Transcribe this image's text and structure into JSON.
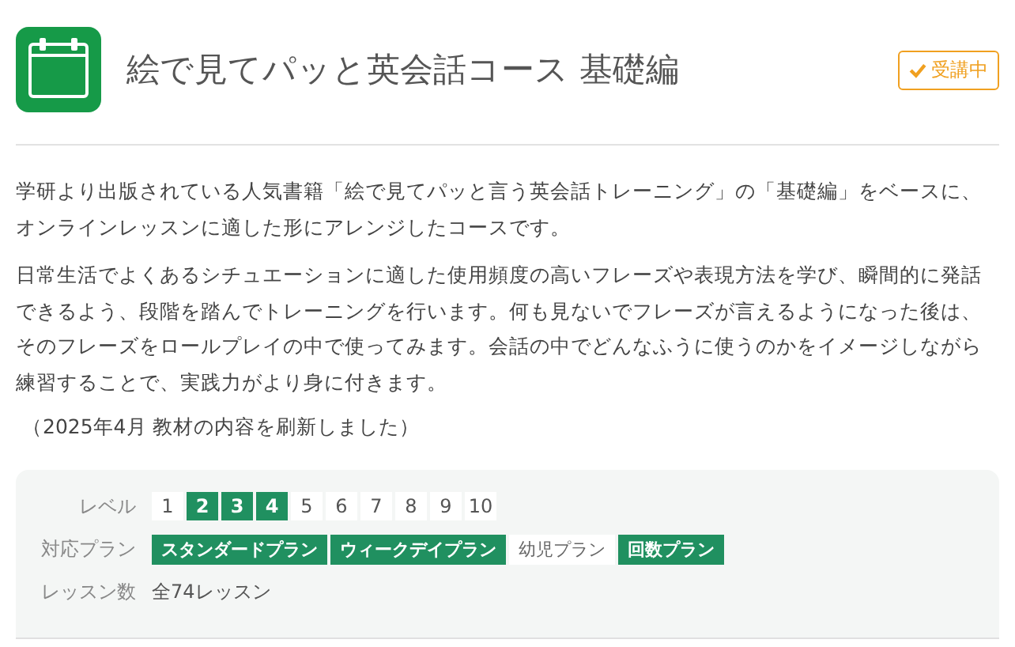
{
  "header": {
    "title": "絵で見てパッと英会話コース 基礎編",
    "status_badge": "受講中"
  },
  "description": [
    "学研より出版されている人気書籍「絵で見てパッと言う英会話トレーニング」の「基礎編」をベースに、オンラインレッスンに適した形にアレンジしたコースです。",
    "日常生活でよくあるシチュエーションに適した使用頻度の高いフレーズや表現方法を学び、瞬間的に発話できるよう、段階を踏んでトレーニングを行います。何も見ないでフレーズが言えるようになった後は、そのフレーズをロールプレイの中で使ってみます。会話の中でどんなふうに使うのかをイメージしながら練習することで、実践力がより身に付きます。"
  ],
  "update_note": "（2025年4月 教材の内容を刷新しました）",
  "info": {
    "level_label": "レベル",
    "levels": [
      {
        "label": "1",
        "selected": false
      },
      {
        "label": "2",
        "selected": true
      },
      {
        "label": "3",
        "selected": true
      },
      {
        "label": "4",
        "selected": true
      },
      {
        "label": "5",
        "selected": false
      },
      {
        "label": "6",
        "selected": false
      },
      {
        "label": "7",
        "selected": false
      },
      {
        "label": "8",
        "selected": false
      },
      {
        "label": "9",
        "selected": false
      },
      {
        "label": "10",
        "selected": false
      }
    ],
    "plan_label": "対応プラン",
    "plans": [
      {
        "label": "スタンダードプラン",
        "selected": true
      },
      {
        "label": "ウィークデイプラン",
        "selected": true
      },
      {
        "label": "幼児プラン",
        "selected": false
      },
      {
        "label": "回数プラン",
        "selected": true
      }
    ],
    "lessons_label": "レッスン数",
    "lessons_value": "全74レッスン"
  }
}
